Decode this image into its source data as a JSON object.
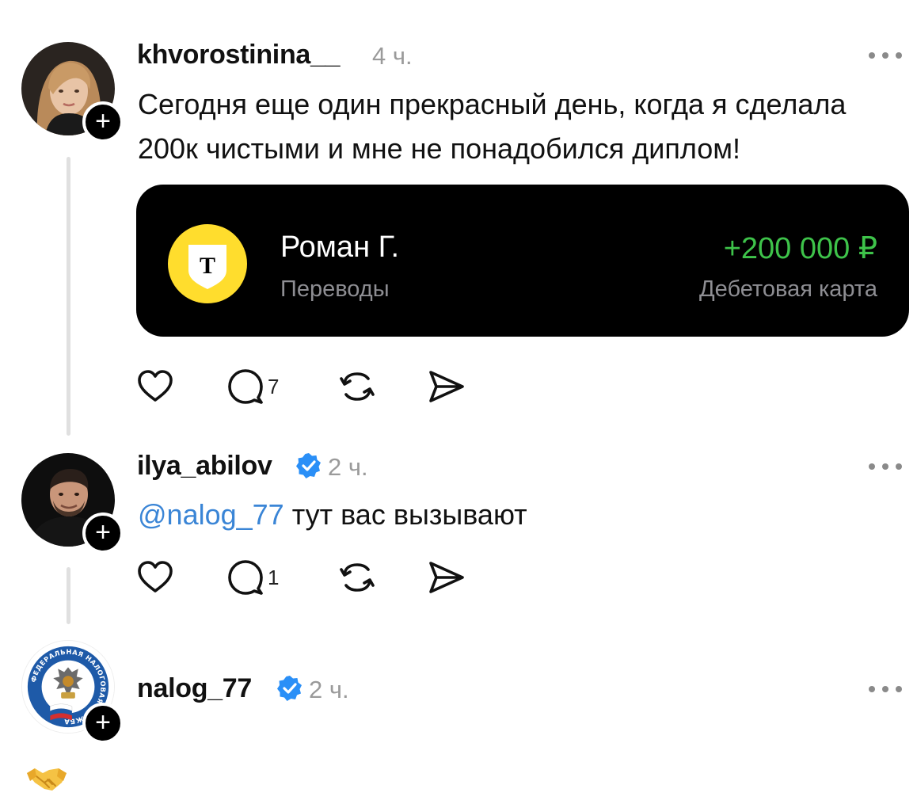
{
  "posts": [
    {
      "username": "khvorostinina__",
      "time": "4 ч.",
      "text": "Сегодня еще один прекрасный день, когда я сделала 200к чистыми и мне не понадобился диплом!",
      "avatar_icon": "avatar-woman",
      "card": {
        "bank_logo_letter": "T",
        "name": "Роман Г.",
        "category": "Переводы",
        "amount": "+200 000 ₽",
        "account": "Дебетовая карта",
        "amount_color": "#3ec34a",
        "bank_color": "#ffdd2d"
      },
      "reply_count": "7"
    },
    {
      "username": "ilya_abilov",
      "verified": true,
      "time": "2 ч.",
      "mention": "@nalog_77",
      "text": " тут вас вызывают",
      "avatar_icon": "avatar-man",
      "reply_count": "1"
    },
    {
      "username": "nalog_77",
      "verified": true,
      "time": "2 ч.",
      "avatar_icon": "federal-tax-service-emblem",
      "avatar_text": "ФЕДЕРАЛЬНАЯ НАЛОГОВАЯ СЛУЖБА",
      "reply_emoji": "🤝"
    }
  ],
  "icons": {
    "like": "heart-icon",
    "reply": "comment-icon",
    "repost": "repost-icon",
    "share": "send-icon",
    "more": "more-dots-icon",
    "follow": "plus-icon",
    "verified": "verified-badge-icon"
  },
  "colors": {
    "verified": "#2a8ff7",
    "mention": "#3a85d6",
    "time": "#9a9a9a"
  }
}
